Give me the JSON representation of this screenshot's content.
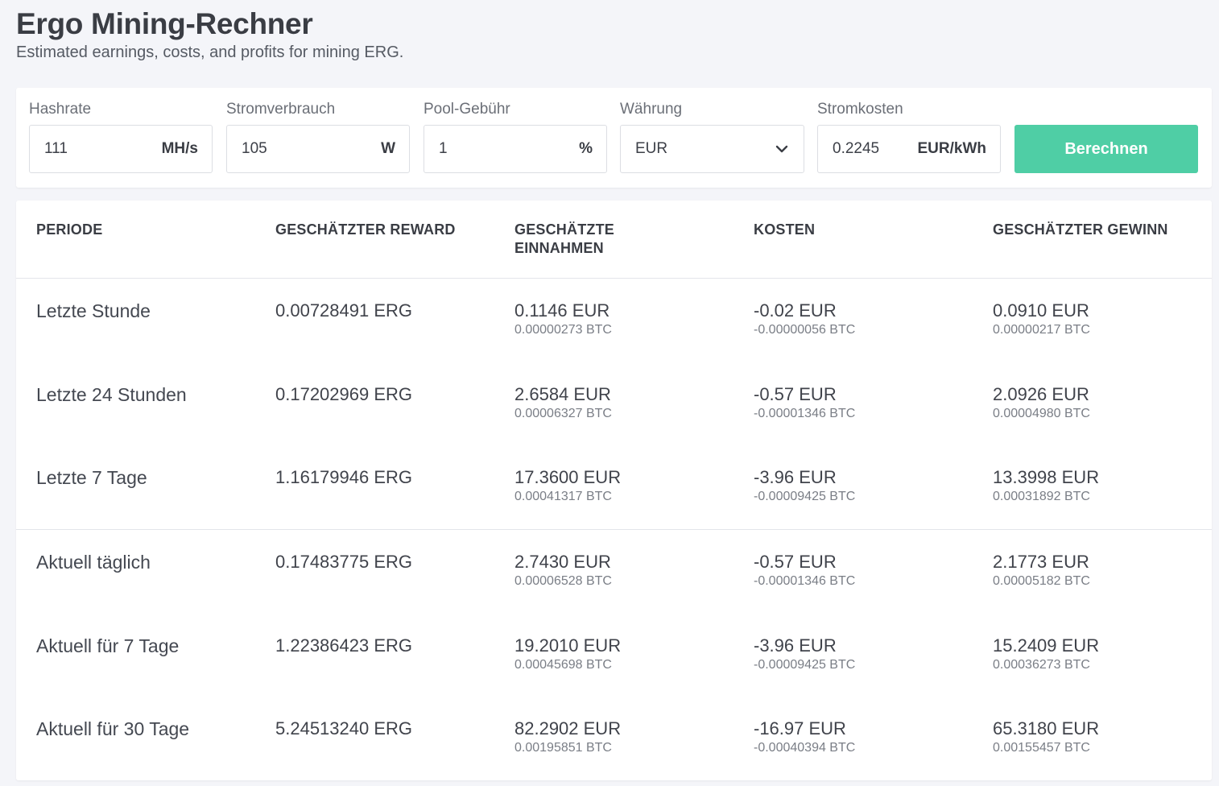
{
  "header": {
    "title": "Ergo Mining-Rechner",
    "subtitle": "Estimated earnings, costs, and profits for mining ERG."
  },
  "form": {
    "hashrate": {
      "label": "Hashrate",
      "value": "111",
      "unit": "MH/s"
    },
    "power": {
      "label": "Stromverbrauch",
      "value": "105",
      "unit": "W"
    },
    "pool_fee": {
      "label": "Pool-Gebühr",
      "value": "1",
      "unit": "%"
    },
    "currency": {
      "label": "Währung",
      "value": "EUR"
    },
    "electricity": {
      "label": "Stromkosten",
      "value": "0.2245",
      "unit": "EUR/kWh"
    },
    "submit_label": "Berechnen"
  },
  "table": {
    "headers": {
      "period": "PERIODE",
      "reward": "GESCHÄTZTER REWARD",
      "revenue": "GESCHÄTZTE EINNAHMEN",
      "costs": "KOSTEN",
      "profit": "GESCHÄTZTER GEWINN"
    },
    "rows": [
      {
        "period": "Letzte Stunde",
        "reward": "0.00728491 ERG",
        "revenue": "0.1146 EUR",
        "revenue_btc": "0.00000273 BTC",
        "costs": "-0.02 EUR",
        "costs_btc": "-0.00000056 BTC",
        "profit": "0.0910 EUR",
        "profit_btc": "0.00000217 BTC"
      },
      {
        "period": "Letzte 24 Stunden",
        "reward": "0.17202969 ERG",
        "revenue": "2.6584 EUR",
        "revenue_btc": "0.00006327 BTC",
        "costs": "-0.57 EUR",
        "costs_btc": "-0.00001346 BTC",
        "profit": "2.0926 EUR",
        "profit_btc": "0.00004980 BTC"
      },
      {
        "period": "Letzte 7 Tage",
        "reward": "1.16179946 ERG",
        "revenue": "17.3600 EUR",
        "revenue_btc": "0.00041317 BTC",
        "costs": "-3.96 EUR",
        "costs_btc": "-0.00009425 BTC",
        "profit": "13.3998 EUR",
        "profit_btc": "0.00031892 BTC"
      },
      {
        "period": "Aktuell täglich",
        "reward": "0.17483775 ERG",
        "revenue": "2.7430 EUR",
        "revenue_btc": "0.00006528 BTC",
        "costs": "-0.57 EUR",
        "costs_btc": "-0.00001346 BTC",
        "profit": "2.1773 EUR",
        "profit_btc": "0.00005182 BTC"
      },
      {
        "period": "Aktuell für 7 Tage",
        "reward": "1.22386423 ERG",
        "revenue": "19.2010 EUR",
        "revenue_btc": "0.00045698 BTC",
        "costs": "-3.96 EUR",
        "costs_btc": "-0.00009425 BTC",
        "profit": "15.2409 EUR",
        "profit_btc": "0.00036273 BTC"
      },
      {
        "period": "Aktuell für 30 Tage",
        "reward": "5.24513240 ERG",
        "revenue": "82.2902 EUR",
        "revenue_btc": "0.00195851 BTC",
        "costs": "-16.97 EUR",
        "costs_btc": "-0.00040394 BTC",
        "profit": "65.3180 EUR",
        "profit_btc": "0.00155457 BTC"
      }
    ]
  }
}
